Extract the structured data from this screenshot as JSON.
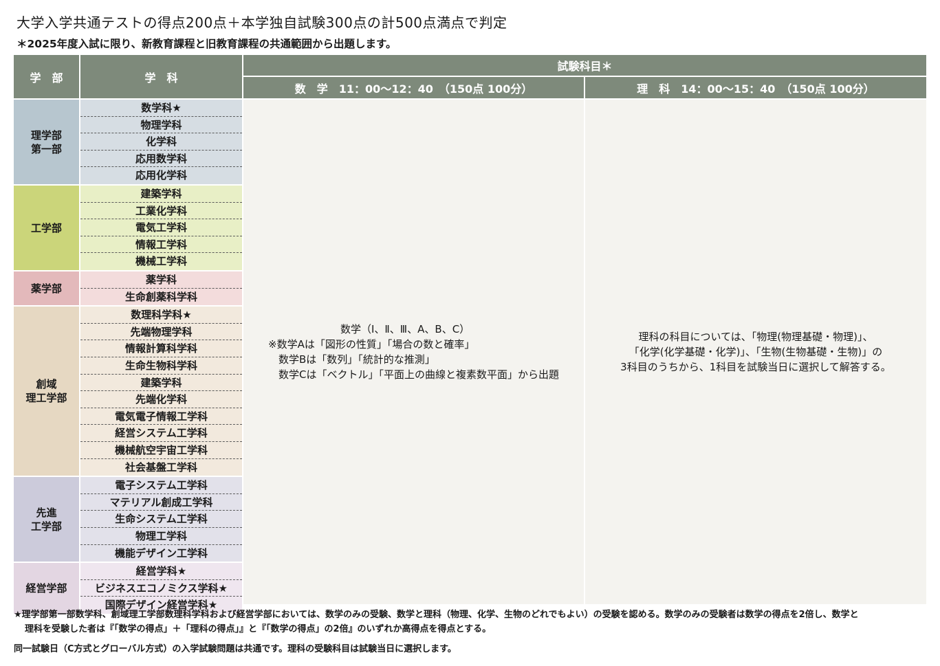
{
  "title": "大学入学共通テストの得点200点＋本学独自試験300点の計500点満点で判定",
  "note_top": "＊2025年度入試に限り、新教育課程と旧教育課程の共通範囲から出題します。",
  "header": {
    "faculty": "学　部",
    "department": "学　科",
    "subjects": "試験科目＊",
    "math": "数　学　11：00～12：40　（150点 100分）",
    "science": "理　科　14：00～15：40　（150点 100分）"
  },
  "faculties": [
    {
      "name": "理学部\n第一部",
      "color": "#b7c6cf",
      "dept_color": "#d6dde3",
      "departments": [
        "数学科★",
        "物理学科",
        "化学科",
        "応用数学科",
        "応用化学科"
      ]
    },
    {
      "name": "工学部",
      "color": "#cbd57a",
      "dept_color": "#e8efc6",
      "departments": [
        "建築学科",
        "工業化学科",
        "電気工学科",
        "情報工学科",
        "機械工学科"
      ]
    },
    {
      "name": "薬学部",
      "color": "#e3b9bb",
      "dept_color": "#f3dcdc",
      "departments": [
        "薬学科",
        "生命創薬科学科"
      ]
    },
    {
      "name": "創域\n理工学部",
      "color": "#e6d8c2",
      "dept_color": "#f2e9dd",
      "departments": [
        "数理科学科★",
        "先端物理学科",
        "情報計算科学科",
        "生命生物科学科",
        "建築学科",
        "先端化学科",
        "電気電子情報工学科",
        "経営システム工学科",
        "機械航空宇宙工学科",
        "社会基盤工学科"
      ]
    },
    {
      "name": "先進\n工学部",
      "color": "#cccbdb",
      "dept_color": "#e2e1ea",
      "departments": [
        "電子システム工学科",
        "マテリアル創成工学科",
        "生命システム工学科",
        "物理工学科",
        "機能デザイン工学科"
      ]
    },
    {
      "name": "経営学部",
      "color": "#e3d6e2",
      "dept_color": "#efe6ef",
      "departments": [
        "経営学科★",
        "ビジネスエコノミクス学科★",
        "国際デザイン経営学科★"
      ]
    }
  ],
  "math_content": "　　　　　　　数学（Ⅰ、Ⅱ、Ⅲ、A、B、C）\n※数学Aは「図形の性質」「場合の数と確率」\n　数学Bは「数列」「統計的な推測」\n　数学Cは「ベクトル」「平面上の曲線と複素数平面」から出題",
  "science_content": "理科の科目については、「物理(物理基礎・物理)」、\n「化学(化学基礎・化学)」、「生物(生物基礎・生物)」の\n3科目のうちから、1科目を試験当日に選択して解答する。",
  "footnote_line1": "★理学部第一部数学科、創域理工学部数理科学科および経営学部においては、数学のみの受験、数学と理科（物理、化学、生物のどれでもよい）の受験を認める。数学のみの受験者は数学の得点を2倍し、数学と",
  "footnote_line2": "理科を受験した者は『「数学の得点」＋「理科の得点」』と『「数学の得点」の2倍』のいずれか高得点を得点とする。",
  "footnote2": "同一試験日（C方式とグローバル方式）の入学試験問題は共通です。理科の受験科目は試験当日に選択します。",
  "colors": {
    "header_bg": "#7e8a7b",
    "subject_bg": "#f4f3ef"
  }
}
